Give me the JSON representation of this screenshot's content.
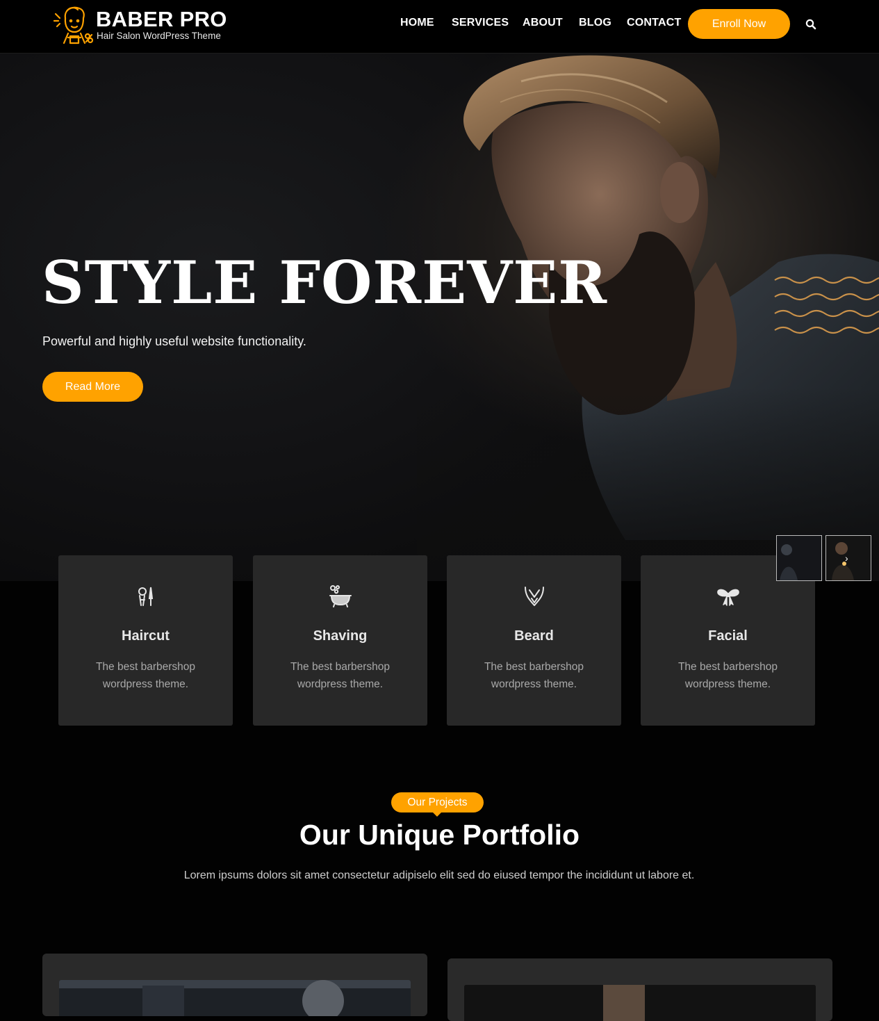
{
  "brand": {
    "title": "BABER PRO",
    "tagline": "Hair Salon WordPress Theme",
    "logo_icon": "barber-logo-icon",
    "accent": "#ffa200"
  },
  "nav": {
    "items": [
      {
        "label": "HOME"
      },
      {
        "label": "SERVICES"
      },
      {
        "label": "ABOUT"
      },
      {
        "label": "BLOG"
      },
      {
        "label": "CONTACT"
      }
    ],
    "cta": "Enroll Now",
    "search_icon": "search-icon"
  },
  "hero": {
    "title": "STYLE FOREVER",
    "subtitle": "Powerful and highly useful website functionality.",
    "button": "Read More",
    "next_arrow": "›"
  },
  "services": [
    {
      "icon": "haircut-icon",
      "title": "Haircut",
      "desc": "The best barbershop wordpress theme."
    },
    {
      "icon": "shaving-icon",
      "title": "Shaving",
      "desc": "The best barbershop wordpress theme."
    },
    {
      "icon": "beard-icon",
      "title": "Beard",
      "desc": "The best barbershop wordpress theme."
    },
    {
      "icon": "facial-icon",
      "title": "Facial",
      "desc": "The best barbershop wordpress theme."
    }
  ],
  "portfolio": {
    "badge": "Our Projects",
    "title": "Our Unique Portfolio",
    "description": "Lorem ipsums dolors sit amet consectetur adipiselo elit sed do eiused tempor the incididunt ut labore et."
  }
}
